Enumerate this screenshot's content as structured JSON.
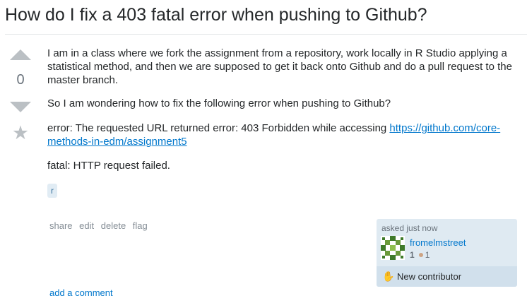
{
  "question": {
    "title": "How do I fix a 403 fatal error when pushing to Github?",
    "vote_count": "0",
    "body": {
      "p1": "I am in a class where we fork the assignment from a repository, work locally in R Studio applying a statistical method, and then we are supposed to get it back onto Github and do a pull request to the master branch.",
      "p2": "So I am wondering how to fix the following error when pushing to Github?",
      "p3_prefix": "error: The requested URL returned error: 403 Forbidden while accessing ",
      "p3_link": "https://github.com/core-methods-in-edm/assignment5",
      "p4": "fatal: HTTP request failed."
    },
    "tags": [
      "r"
    ]
  },
  "post_menu": {
    "share": "share",
    "edit": "edit",
    "delete": "delete",
    "flag": "flag"
  },
  "user_card": {
    "asked_label": "asked just now",
    "username": "fromelmstreet",
    "reputation": "1",
    "bronze_badges": "1",
    "new_contributor_label": "New contributor"
  },
  "comments": {
    "add_comment": "add a comment"
  },
  "colors": {
    "link": "#0077cc",
    "tag_bg": "#e1ecf4",
    "tag_text": "#39739d",
    "user_card_bg": "#dfeaf2",
    "bronze": "#cda484"
  },
  "icons": {
    "upvote": "triangle-up",
    "downvote": "triangle-down",
    "favorite": "star",
    "new_contributor": "waving-hand"
  }
}
